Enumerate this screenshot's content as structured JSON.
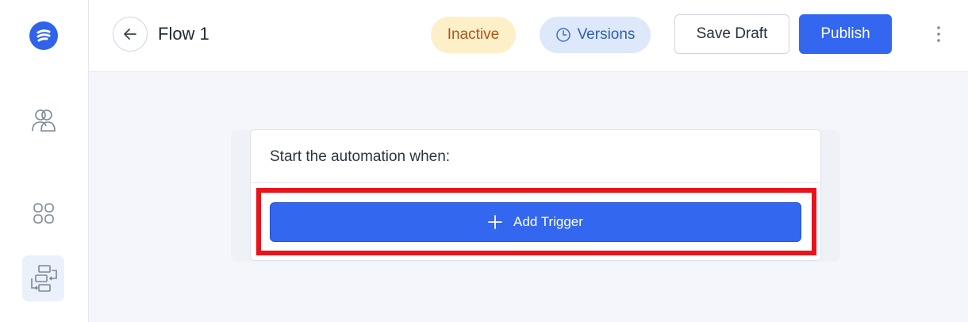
{
  "sidebar": {
    "logo_icon": "brand-logo-icon",
    "items": [
      {
        "icon": "users-icon",
        "active": false
      },
      {
        "icon": "apps-grid-icon",
        "active": false
      },
      {
        "icon": "flows-icon",
        "active": true
      }
    ]
  },
  "header": {
    "back_icon": "arrow-left-icon",
    "title": "Flow 1",
    "status_label": "Inactive",
    "versions_label": "Versions",
    "versions_icon": "clock-icon",
    "save_draft_label": "Save Draft",
    "publish_label": "Publish",
    "more_icon": "vertical-dots-icon"
  },
  "card": {
    "heading": "Start the automation when:",
    "add_trigger_label": "Add Trigger",
    "add_trigger_icon": "plus-icon"
  },
  "colors": {
    "accent": "#3367f0",
    "status_bg": "#fdf0c8",
    "status_text": "#b5521b",
    "versions_bg": "#dde9fa",
    "highlight": "#e8141c"
  }
}
